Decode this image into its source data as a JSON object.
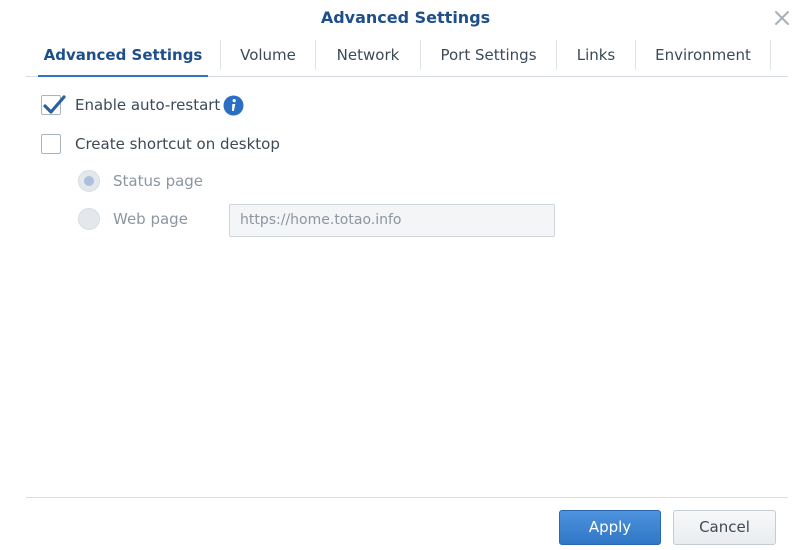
{
  "window": {
    "title": "Advanced Settings"
  },
  "tabs": [
    {
      "label": "Advanced Settings",
      "active": true
    },
    {
      "label": "Volume",
      "active": false
    },
    {
      "label": "Network",
      "active": false
    },
    {
      "label": "Port Settings",
      "active": false
    },
    {
      "label": "Links",
      "active": false
    },
    {
      "label": "Environment",
      "active": false
    }
  ],
  "options": {
    "auto_restart": {
      "label": "Enable auto-restart",
      "checked": true
    },
    "desktop_shortcut": {
      "label": "Create shortcut on desktop",
      "checked": false
    },
    "status_page": {
      "label": "Status page",
      "selected": true,
      "disabled": true
    },
    "web_page": {
      "label": "Web page",
      "selected": false,
      "disabled": true,
      "url_placeholder": "https://home.totao.info"
    }
  },
  "footer": {
    "apply_label": "Apply",
    "cancel_label": "Cancel"
  },
  "colors": {
    "accent": "#2c72c7",
    "title": "#1e4f8a",
    "text": "#3c4a57"
  },
  "icons": {
    "close": "close-icon",
    "info": "info-icon",
    "check": "checkmark-icon"
  }
}
